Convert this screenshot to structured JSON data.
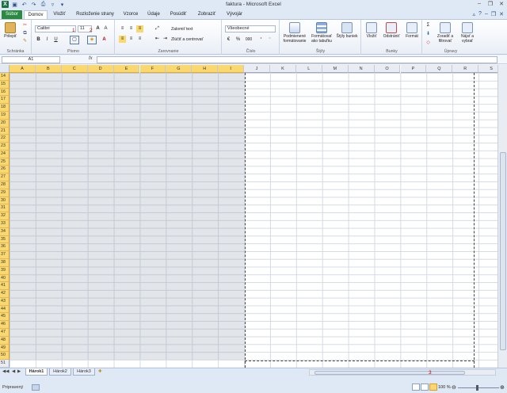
{
  "window": {
    "title": "faktura - Microsoft Excel",
    "qat_icons": [
      "excel-logo-icon",
      "save-icon",
      "undo-icon",
      "redo-icon",
      "print-preview-icon",
      "filter-icon",
      "customize-icon"
    ]
  },
  "tabs": [
    {
      "label": "Súbor",
      "active": false,
      "file": true
    },
    {
      "label": "Domov",
      "active": true
    },
    {
      "label": "Vložiť"
    },
    {
      "label": "Rozloženie strany"
    },
    {
      "label": "Vzorce"
    },
    {
      "label": "Údaje"
    },
    {
      "label": "Posúdiť"
    },
    {
      "label": "Zobraziť"
    },
    {
      "label": "Vývojár"
    }
  ],
  "ribbon": {
    "clipboard": {
      "label": "Schránka",
      "paste": "Prilepiť"
    },
    "font": {
      "label": "Písmo",
      "name": "Calibri",
      "size": "11",
      "bold": "B",
      "italic": "I",
      "underline": "U"
    },
    "alignment": {
      "label": "Zarovnanie",
      "wrap": "Zalomiť text",
      "merge": "Zlúčiť a centrovať"
    },
    "number": {
      "label": "Číslo",
      "format": "Všeobecné",
      "percent": "%",
      "comma": "000"
    },
    "styles": {
      "label": "Štýly",
      "conditional": "Podmienené formátovanie",
      "table": "Formátovať ako tabuľku",
      "cell_styles": "Štýly buniek"
    },
    "cells": {
      "label": "Bunky",
      "insert": "Vložiť",
      "delete": "Odstrániť",
      "format": "Formát"
    },
    "editing": {
      "label": "Úpravy",
      "sort": "Zoradiť a filtrovať",
      "find": "Nájsť a vybrať"
    },
    "annotations": {
      "one": "1",
      "two": "2",
      "three": "3"
    }
  },
  "formula_bar": {
    "name_box": "A1",
    "fx": "fx",
    "content": ""
  },
  "columns": [
    "A",
    "B",
    "C",
    "D",
    "E",
    "F",
    "G",
    "H",
    "I",
    "J",
    "K",
    "L",
    "M",
    "N",
    "O",
    "P",
    "Q",
    "R",
    "S"
  ],
  "rows": [
    "14",
    "15",
    "16",
    "17",
    "18",
    "19",
    "20",
    "21",
    "22",
    "23",
    "24",
    "25",
    "26",
    "27",
    "28",
    "29",
    "30",
    "31",
    "32",
    "33",
    "34",
    "35",
    "36",
    "37",
    "38",
    "39",
    "40",
    "41",
    "42",
    "43",
    "44",
    "45",
    "46",
    "47",
    "48",
    "49",
    "50",
    "51"
  ],
  "sheet_tabs": [
    "Hárok1",
    "Hárok2",
    "Hárok3"
  ],
  "status": {
    "text": "Pripravený",
    "zoom": "100 %"
  },
  "colors": {
    "selection_header": "#f9d96f",
    "file_tab": "#2a8a42",
    "annotation": "#c00000"
  }
}
